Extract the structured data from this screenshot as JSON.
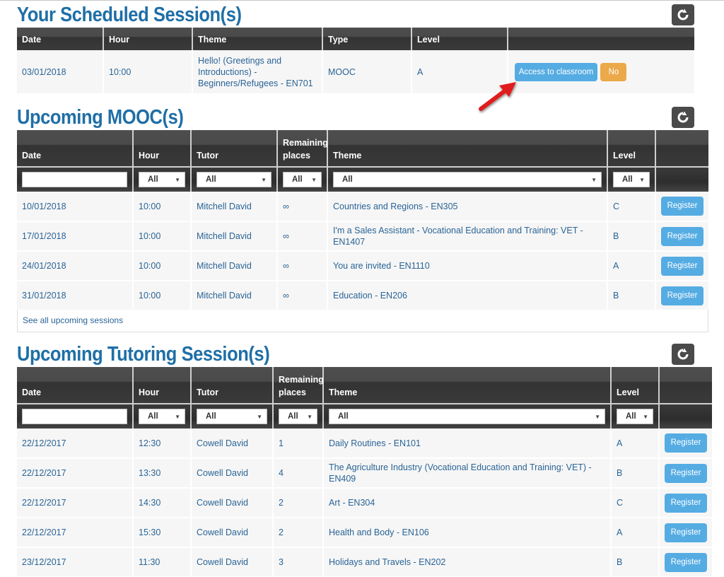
{
  "scheduled": {
    "title": "Your Scheduled Session(s)",
    "refresh_icon": "refresh-icon",
    "columns": [
      "Date",
      "Hour",
      "Theme",
      "Type",
      "Level",
      ""
    ],
    "rows": [
      {
        "date": "03/01/2018",
        "hour": "10:00",
        "theme": "Hello! (Greetings and Introductions) - Beginners/Refugees - EN701",
        "type": "MOOC",
        "level": "A",
        "access_label": "Access to classroom",
        "no_label": "No"
      }
    ],
    "colors": {
      "access": "#55ace3",
      "no": "#eba94a",
      "arrow": "#e01b1b"
    }
  },
  "mooc": {
    "title": "Upcoming MOOC(s)",
    "refresh_icon": "refresh-icon",
    "columns": [
      "Date",
      "Hour",
      "Tutor",
      "Remaining places",
      "Theme",
      "Level",
      ""
    ],
    "filters": {
      "date_value": "",
      "hour": "All",
      "tutor": "All",
      "places": "All",
      "theme": "All",
      "level": "All"
    },
    "rows": [
      {
        "date": "10/01/2018",
        "hour": "10:00",
        "tutor": "Mitchell David",
        "places": "∞",
        "theme": "Countries and Regions - EN305",
        "level": "C",
        "action": "Register"
      },
      {
        "date": "17/01/2018",
        "hour": "10:00",
        "tutor": "Mitchell David",
        "places": "∞",
        "theme": "I'm a Sales Assistant - Vocational Education and Training: VET - EN1407",
        "level": "B",
        "action": "Register"
      },
      {
        "date": "24/01/2018",
        "hour": "10:00",
        "tutor": "Mitchell David",
        "places": "∞",
        "theme": "You are invited - EN1110",
        "level": "A",
        "action": "Register"
      },
      {
        "date": "31/01/2018",
        "hour": "10:00",
        "tutor": "Mitchell David",
        "places": "∞",
        "theme": "Education - EN206",
        "level": "B",
        "action": "Register"
      }
    ],
    "see_all": "See all upcoming sessions"
  },
  "tutoring": {
    "title": "Upcoming Tutoring Session(s)",
    "refresh_icon": "refresh-icon",
    "columns": [
      "Date",
      "Hour",
      "Tutor",
      "Remaining places",
      "Theme",
      "Level",
      ""
    ],
    "filters": {
      "date_value": "",
      "hour": "All",
      "tutor": "All",
      "places": "All",
      "theme": "All",
      "level": "All"
    },
    "rows": [
      {
        "date": "22/12/2017",
        "hour": "12:30",
        "tutor": "Cowell David",
        "places": "1",
        "theme": "Daily Routines - EN101",
        "level": "A",
        "action": "Register"
      },
      {
        "date": "22/12/2017",
        "hour": "13:30",
        "tutor": "Cowell David",
        "places": "4",
        "theme": "The Agriculture Industry (Vocational Education and Training: VET) - EN409",
        "level": "B",
        "action": "Register"
      },
      {
        "date": "22/12/2017",
        "hour": "14:30",
        "tutor": "Cowell David",
        "places": "2",
        "theme": "Art - EN304",
        "level": "C",
        "action": "Register"
      },
      {
        "date": "22/12/2017",
        "hour": "15:30",
        "tutor": "Cowell David",
        "places": "2",
        "theme": "Health and Body - EN106",
        "level": "A",
        "action": "Register"
      },
      {
        "date": "23/12/2017",
        "hour": "11:30",
        "tutor": "Cowell David",
        "places": "3",
        "theme": "Holidays and Travels - EN202",
        "level": "B",
        "action": "Register"
      }
    ]
  }
}
